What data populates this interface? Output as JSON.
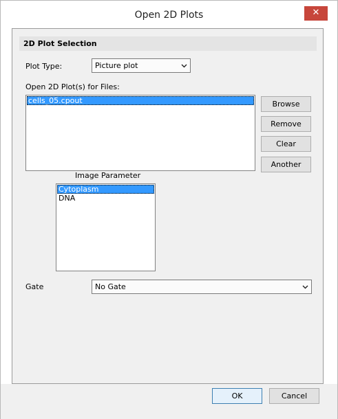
{
  "window": {
    "title": "Open 2D Plots",
    "close_glyph": "✕"
  },
  "section": {
    "header": "2D Plot Selection"
  },
  "plot_type": {
    "label": "Plot Type:",
    "value": "Picture plot"
  },
  "files": {
    "label": "Open 2D Plot(s) for Files:",
    "items": [
      {
        "text": "cells_05.cpout",
        "selected": true
      }
    ]
  },
  "file_buttons": {
    "browse": "Browse",
    "remove": "Remove",
    "clear": "Clear",
    "another": "Another"
  },
  "image_parameter": {
    "label": "Image Parameter",
    "items": [
      {
        "text": "Cytoplasm",
        "selected": true
      },
      {
        "text": "DNA",
        "selected": false
      }
    ]
  },
  "gate": {
    "label": "Gate",
    "value": "No Gate"
  },
  "footer": {
    "ok": "OK",
    "cancel": "Cancel"
  },
  "colors": {
    "selection": "#3399ff",
    "close_button": "#c7463b"
  }
}
